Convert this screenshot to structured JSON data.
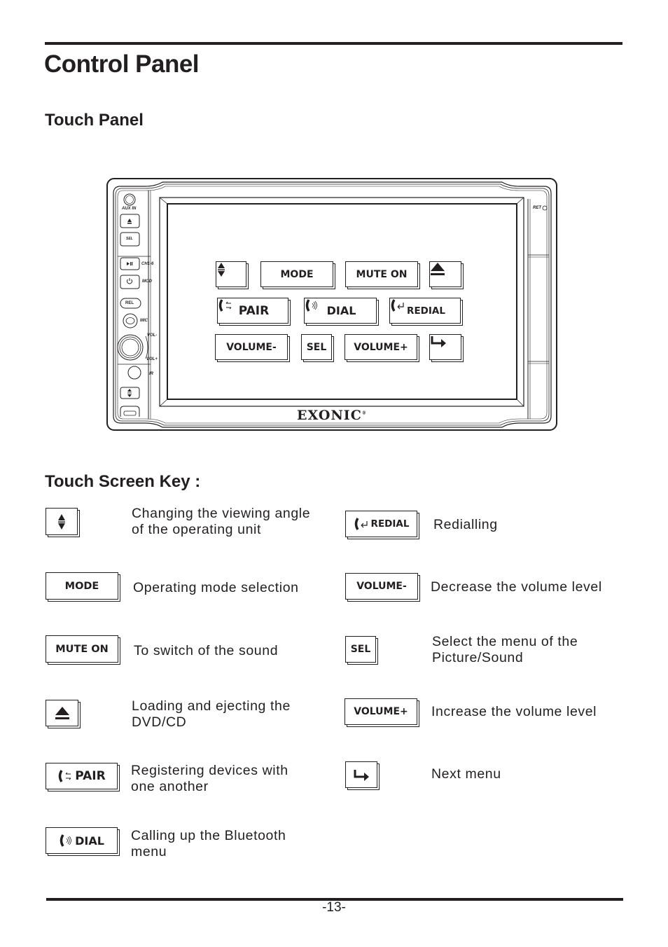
{
  "page": {
    "title": "Control Panel",
    "section_touch_panel": "Touch Panel",
    "section_touch_screen_key": "Touch Screen Key :",
    "page_number": "-13-"
  },
  "device": {
    "brand": "EXONIC",
    "brand_mark": "®",
    "left_panel_labels": {
      "aux_in": "AUX IN",
      "sel": "SEL",
      "ch": "CH1-6",
      "mod": "MOD",
      "rel": "REL",
      "mic": "MIC",
      "vol_minus": "VOL-",
      "vol_plus": "VOL+",
      "ir": "IR"
    },
    "right_panel_labels": {
      "ret": "RET"
    },
    "screen_keys": [
      {
        "id": "angle",
        "label": "",
        "icon": "angle-up-down-icon"
      },
      {
        "id": "mode",
        "label": "MODE",
        "icon": ""
      },
      {
        "id": "mute",
        "label": "MUTE ON",
        "icon": ""
      },
      {
        "id": "eject",
        "label": "",
        "icon": "eject-icon"
      },
      {
        "id": "pair",
        "label": "PAIR",
        "icon": "phone-pair-icon"
      },
      {
        "id": "dial",
        "label": "DIAL",
        "icon": "phone-dial-icon"
      },
      {
        "id": "redial",
        "label": "REDIAL",
        "icon": "phone-redial-icon"
      },
      {
        "id": "volume_minus",
        "label": "VOLUME-",
        "icon": ""
      },
      {
        "id": "sel",
        "label": "SEL",
        "icon": ""
      },
      {
        "id": "volume_plus",
        "label": "VOLUME+",
        "icon": ""
      },
      {
        "id": "next",
        "label": "",
        "icon": "next-menu-arrow-icon"
      }
    ]
  },
  "key_legend": {
    "left": [
      {
        "key": "",
        "icon": "angle-up-down-icon",
        "desc": [
          "Changing the viewing angle",
          "of the operating unit"
        ]
      },
      {
        "key": "MODE",
        "icon": "",
        "desc": [
          "Operating mode selection"
        ]
      },
      {
        "key": "MUTE ON",
        "icon": "",
        "desc": [
          "To switch of the sound"
        ]
      },
      {
        "key": "",
        "icon": "eject-icon",
        "desc": [
          "Loading and ejecting the",
          "DVD/CD"
        ]
      },
      {
        "key": "PAIR",
        "icon": "phone-pair-icon",
        "desc": [
          "Registering devices with",
          "one another"
        ]
      },
      {
        "key": "DIAL",
        "icon": "phone-dial-icon",
        "desc": [
          "Calling up the Bluetooth",
          "menu"
        ]
      }
    ],
    "right": [
      {
        "key": "REDIAL",
        "icon": "phone-redial-icon",
        "desc": [
          "Redialling"
        ]
      },
      {
        "key": "VOLUME-",
        "icon": "",
        "desc": [
          "Decrease the volume level"
        ]
      },
      {
        "key": "SEL",
        "icon": "",
        "desc": [
          "Select the menu of the",
          "Picture/Sound"
        ]
      },
      {
        "key": "VOLUME+",
        "icon": "",
        "desc": [
          "Increase the volume level"
        ]
      },
      {
        "key": "",
        "icon": "next-menu-arrow-icon",
        "desc": [
          "Next menu"
        ]
      }
    ]
  }
}
